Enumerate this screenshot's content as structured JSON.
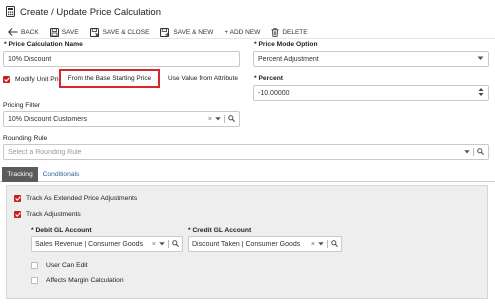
{
  "header": {
    "title": "Create / Update Price Calculation"
  },
  "toolbar": {
    "back": "BACK",
    "save": "SAVE",
    "save_close": "SAVE & CLOSE",
    "save_new": "SAVE & NEW",
    "add_new": "+ ADD NEW",
    "delete": "DELETE"
  },
  "form": {
    "price_calc_name": {
      "label": "Price Calculation Name",
      "value": "10% Discount"
    },
    "price_mode": {
      "label": "Price Mode Option",
      "value": "Percent Adjustment"
    },
    "modify_unit_price": {
      "label": "Modify Unit Price",
      "checked": true
    },
    "price_source": {
      "selected": "From the Base Starting Price",
      "alternative": "Use Value from Attribute"
    },
    "percent": {
      "label": "Percent",
      "value": "-10.00000"
    },
    "pricing_filter": {
      "label": "Pricing Filter",
      "value": "10% Discount Customers"
    },
    "rounding_rule": {
      "label": "Rounding Rule",
      "placeholder": "Select a Rounding Rule"
    }
  },
  "tabs": [
    {
      "label": "Tracking",
      "active": true
    },
    {
      "label": "Conditionals",
      "active": false
    }
  ],
  "tracking": {
    "track_ext_price": {
      "label": "Track As Extended Price Adjustments",
      "checked": true
    },
    "track_adjustments": {
      "label": "Track Adjustments",
      "checked": true
    },
    "debit_gl": {
      "label": "Debit GL Account",
      "value": "Sales Revenue | Consumer Goods"
    },
    "credit_gl": {
      "label": "Credit GL Account",
      "value": "Discount Taken | Consumer Goods"
    },
    "user_can_edit": {
      "label": "User Can Edit",
      "checked": false
    },
    "affects_margin": {
      "label": "Affects Margin Calculation",
      "checked": false
    }
  },
  "colors": {
    "accent": "#c61f26",
    "tab_active": "#5b5b5b",
    "link": "#2f5f9e",
    "panel_bg": "#eeeeee"
  }
}
